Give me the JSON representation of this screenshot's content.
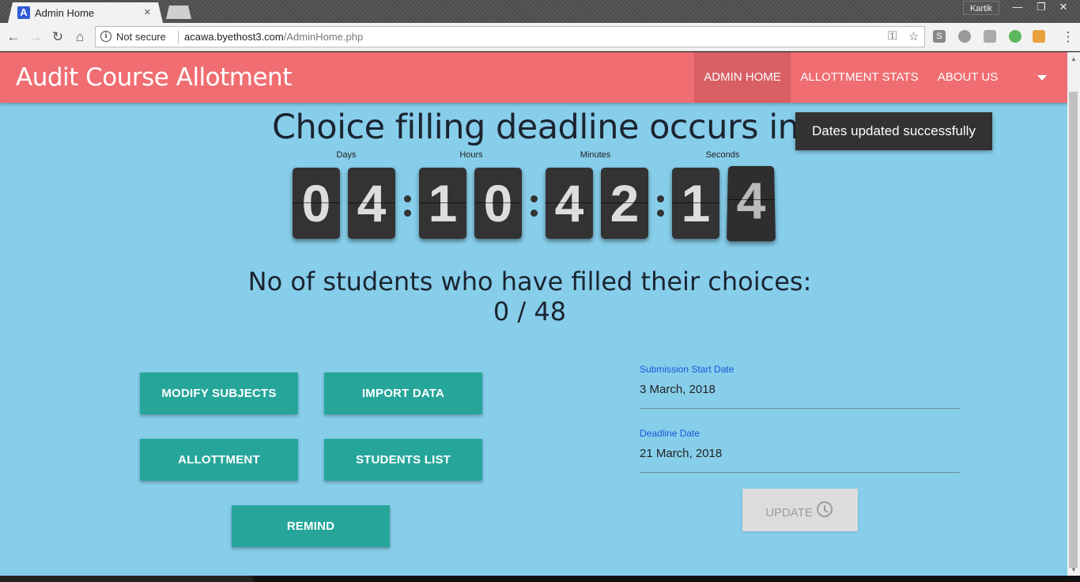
{
  "browser": {
    "tab_title": "Admin Home",
    "tab_favicon": "A",
    "tab_close": "×",
    "profile": "Kartik",
    "window_controls": [
      "—",
      "❐",
      "✕"
    ],
    "security_text": "Not secure",
    "url_host": "acawa.byethost3.com",
    "url_path": "/AdminHome.php",
    "icons": [
      "back-icon",
      "forward-icon",
      "reload-icon",
      "home-icon",
      "info-icon",
      "key-icon",
      "star-icon"
    ]
  },
  "navbar": {
    "brand": "Audit Course Allotment",
    "links": [
      "ADMIN HOME",
      "ALLOTTMENT STATS",
      "ABOUT US"
    ],
    "accent": "#f06d72"
  },
  "countdown": {
    "title": "Choice filling deadline occurs in ...",
    "labels": [
      "Days",
      "Hours",
      "Minutes",
      "Seconds"
    ],
    "digits": [
      "0",
      "4",
      "1",
      "0",
      "4",
      "2",
      "1",
      "4"
    ]
  },
  "toast": {
    "message": "Dates updated successfully"
  },
  "stats": {
    "label": "No of students who have filled their choices:",
    "value": "0 / 48"
  },
  "actions": {
    "modify_subjects": "MODIFY SUBJECTS",
    "import_data": "IMPORT DATA",
    "allotment": "ALLOTTMENT",
    "students_list": "STUDENTS LIST",
    "remind": "REMIND",
    "color": "#26a69a"
  },
  "dates": {
    "start_label": "Submission Start Date",
    "start_value": "3 March, 2018",
    "deadline_label": "Deadline Date",
    "deadline_value": "21 March, 2018",
    "update_label": "UPDATE"
  }
}
